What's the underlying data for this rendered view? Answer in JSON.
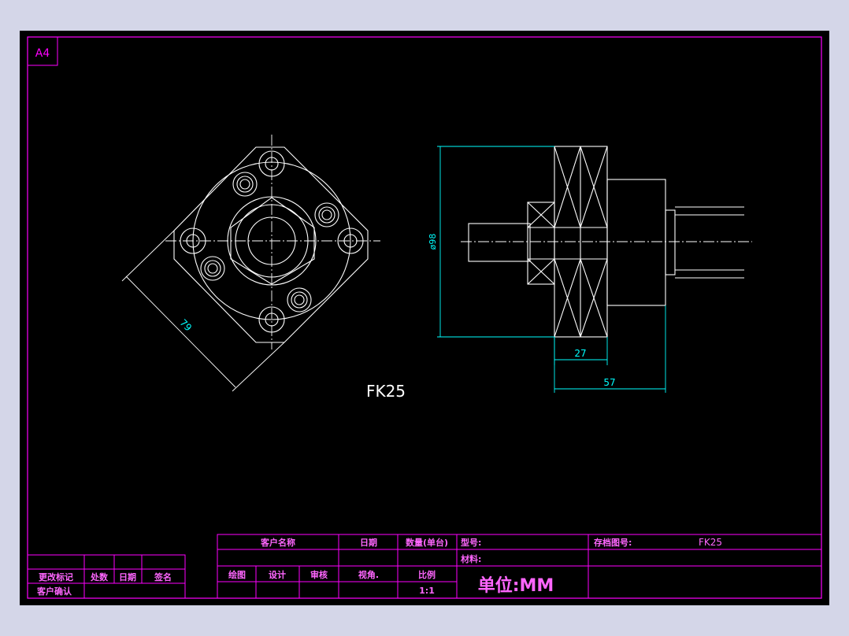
{
  "colors": {
    "background_outer": "#d4d6e8",
    "sheet": "#000000",
    "border": "#ff00ff",
    "outline": "#ffffff",
    "dimension": "#00ffff",
    "title_text": "#ff66ff"
  },
  "sheet_size_label": "A4",
  "part_label": "FK25",
  "dimensions": {
    "front_diagonal": "79",
    "side_diameter": "ø98",
    "flange_width": "27",
    "overall_length": "57"
  },
  "revision_block": {
    "change_mark": "更改标记",
    "count": "处数",
    "date": "日期",
    "sign": "签名",
    "customer_confirm": "客户确认"
  },
  "title_block": {
    "customer_name": "客户名称",
    "date": "日期",
    "quantity": "数量(单台)",
    "model_label": "型号:",
    "archive_no_label": "存档图号:",
    "archive_no_value": "FK25",
    "material_label": "材料:",
    "drawing": "绘图",
    "design": "设计",
    "review": "审核",
    "view_angle": "视角.",
    "scale_label": "比例",
    "scale_value": "1:1",
    "unit": "单位:MM"
  }
}
